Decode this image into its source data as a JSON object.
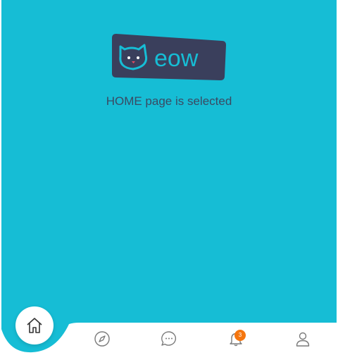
{
  "logo": {
    "text": "eow"
  },
  "status_message": "HOME page is selected",
  "tabs": [
    {
      "name": "home",
      "icon": "home-icon",
      "selected": true
    },
    {
      "name": "explore",
      "icon": "compass-icon",
      "selected": false
    },
    {
      "name": "messages",
      "icon": "chat-bubble-icon",
      "selected": false
    },
    {
      "name": "notifications",
      "icon": "bell-icon",
      "selected": false,
      "badge": "3"
    },
    {
      "name": "profile",
      "icon": "user-icon",
      "selected": false
    }
  ],
  "colors": {
    "background": "#16bdd5",
    "logo_bg": "#3a3f5c",
    "text": "#3a4a63",
    "badge": "#f5760f",
    "icon": "#7a7a7a"
  }
}
